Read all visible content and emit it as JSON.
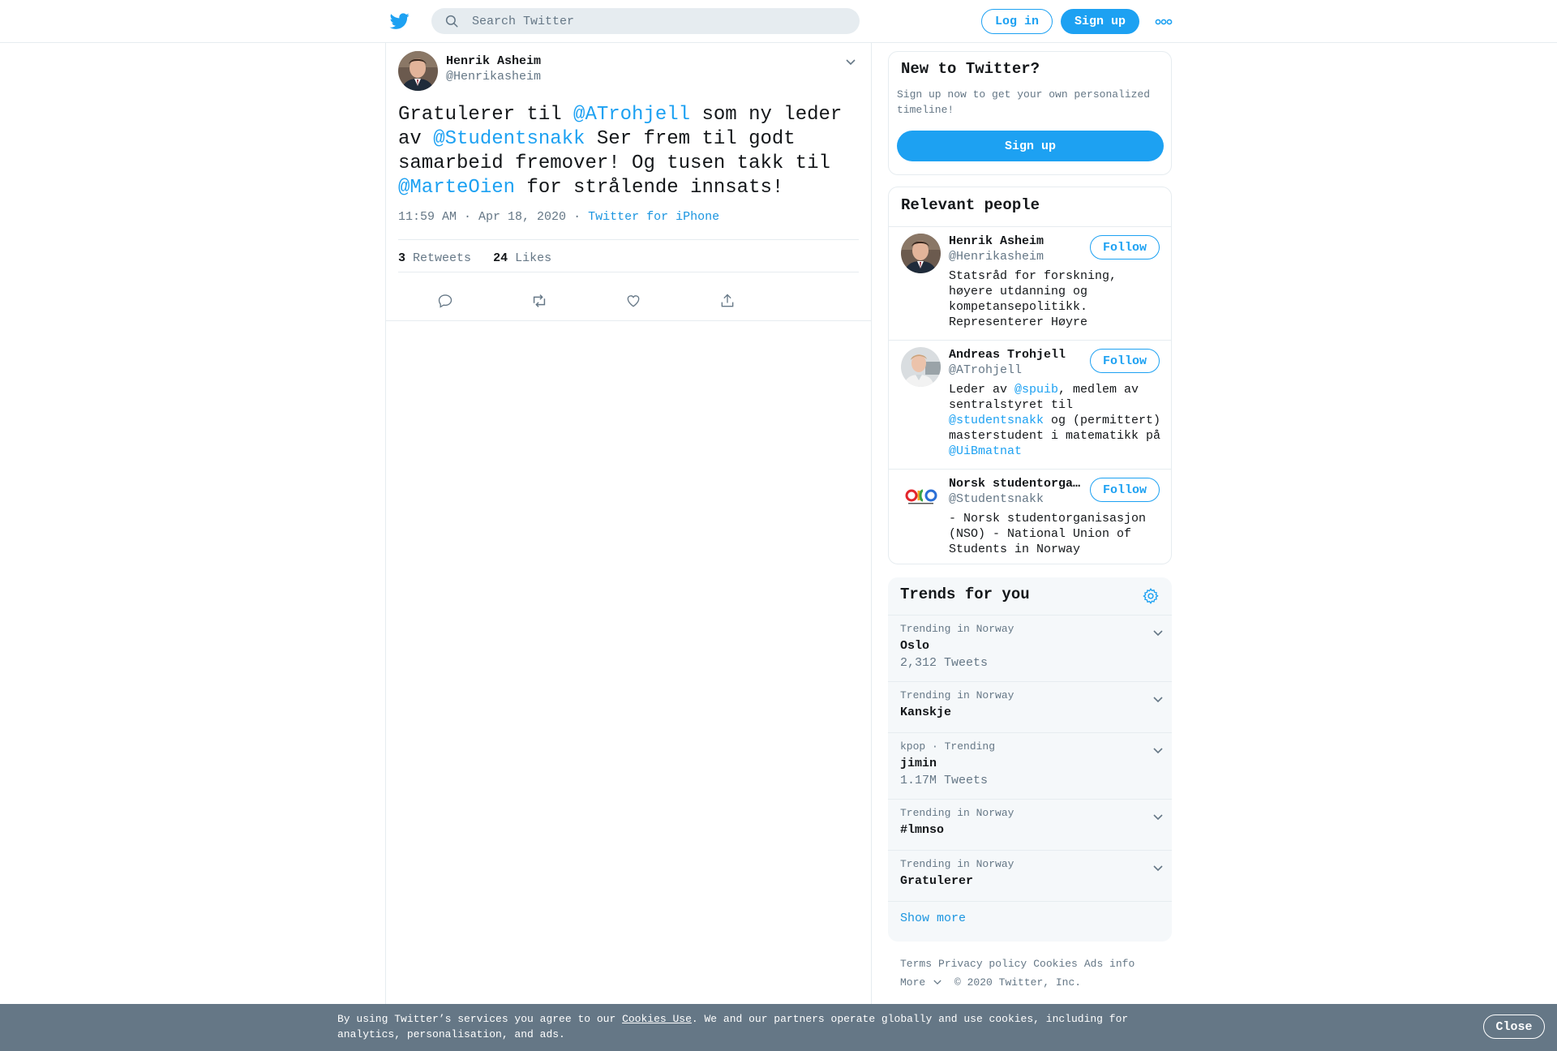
{
  "header": {
    "search_placeholder": "Search Twitter",
    "login_label": "Log in",
    "signup_label": "Sign up"
  },
  "tweet": {
    "author_name": "Henrik Asheim",
    "author_handle": "@Henrikasheim",
    "text_parts": [
      "Gratulerer til ",
      "@ATrohjell",
      " som ny leder av ",
      "@Studentsnakk",
      " Ser frem til godt samarbeid fremover! Og tusen takk til ",
      "@MarteOien",
      " for strålende innsats!"
    ],
    "timestamp": "11:59 AM · Apr 18, 2020",
    "separator": "·",
    "source": "Twitter for iPhone",
    "retweets_count": "3",
    "retweets_label": "Retweets",
    "likes_count": "24",
    "likes_label": "Likes"
  },
  "new_to_twitter": {
    "title": "New to Twitter?",
    "description": "Sign up now to get your own personalized timeline!",
    "signup_label": "Sign up"
  },
  "relevant_people": {
    "title": "Relevant people",
    "follow_label": "Follow",
    "people": [
      {
        "name": "Henrik Asheim",
        "handle": "@Henrikasheim",
        "bio_parts": [
          "Statsråd for forskning, høyere utdanning og kompetansepolitikk. Representerer Høyre"
        ]
      },
      {
        "name": "Andreas Trohjell",
        "handle": "@ATrohjell",
        "bio_parts": [
          "Leder av ",
          "@spuib",
          ", medlem av sentralstyret til ",
          "@studentsnakk",
          " og (permittert) masterstudent i matematikk på ",
          "@UiBmatnat"
        ]
      },
      {
        "name": "Norsk studentorganisasjon",
        "handle": "@Studentsnakk",
        "bio_parts": [
          "- Norsk studentorganisasjon (NSO) - National Union of Students in Norway"
        ]
      }
    ]
  },
  "trends": {
    "title": "Trends for you",
    "items": [
      {
        "context": "Trending in Norway",
        "name": "Oslo",
        "count": "2,312 Tweets"
      },
      {
        "context": "Trending in Norway",
        "name": "Kanskje",
        "count": ""
      },
      {
        "context": "kpop · Trending",
        "name": "jimin",
        "count": "1.17M Tweets"
      },
      {
        "context": "Trending in Norway",
        "name": "#lmnso",
        "count": ""
      },
      {
        "context": "Trending in Norway",
        "name": "Gratulerer",
        "count": ""
      }
    ],
    "show_more": "Show more"
  },
  "footer": {
    "links": [
      "Terms",
      "Privacy policy",
      "Cookies",
      "Ads info"
    ],
    "more_label": "More",
    "copyright": "© 2020 Twitter, Inc."
  },
  "cookie_bar": {
    "text_before": "By using Twitter’s services you agree to our ",
    "link_label": "Cookies Use",
    "text_after": ". We and our partners operate globally and use cookies, including for analytics, personalisation, and ads.",
    "close_label": "Close"
  },
  "colors": {
    "brand_blue": "#1da1f2",
    "link_blue": "#1b95e0",
    "muted_text": "#657786",
    "border": "#e6ecf0",
    "cookie_bar_bg": "#657786"
  }
}
